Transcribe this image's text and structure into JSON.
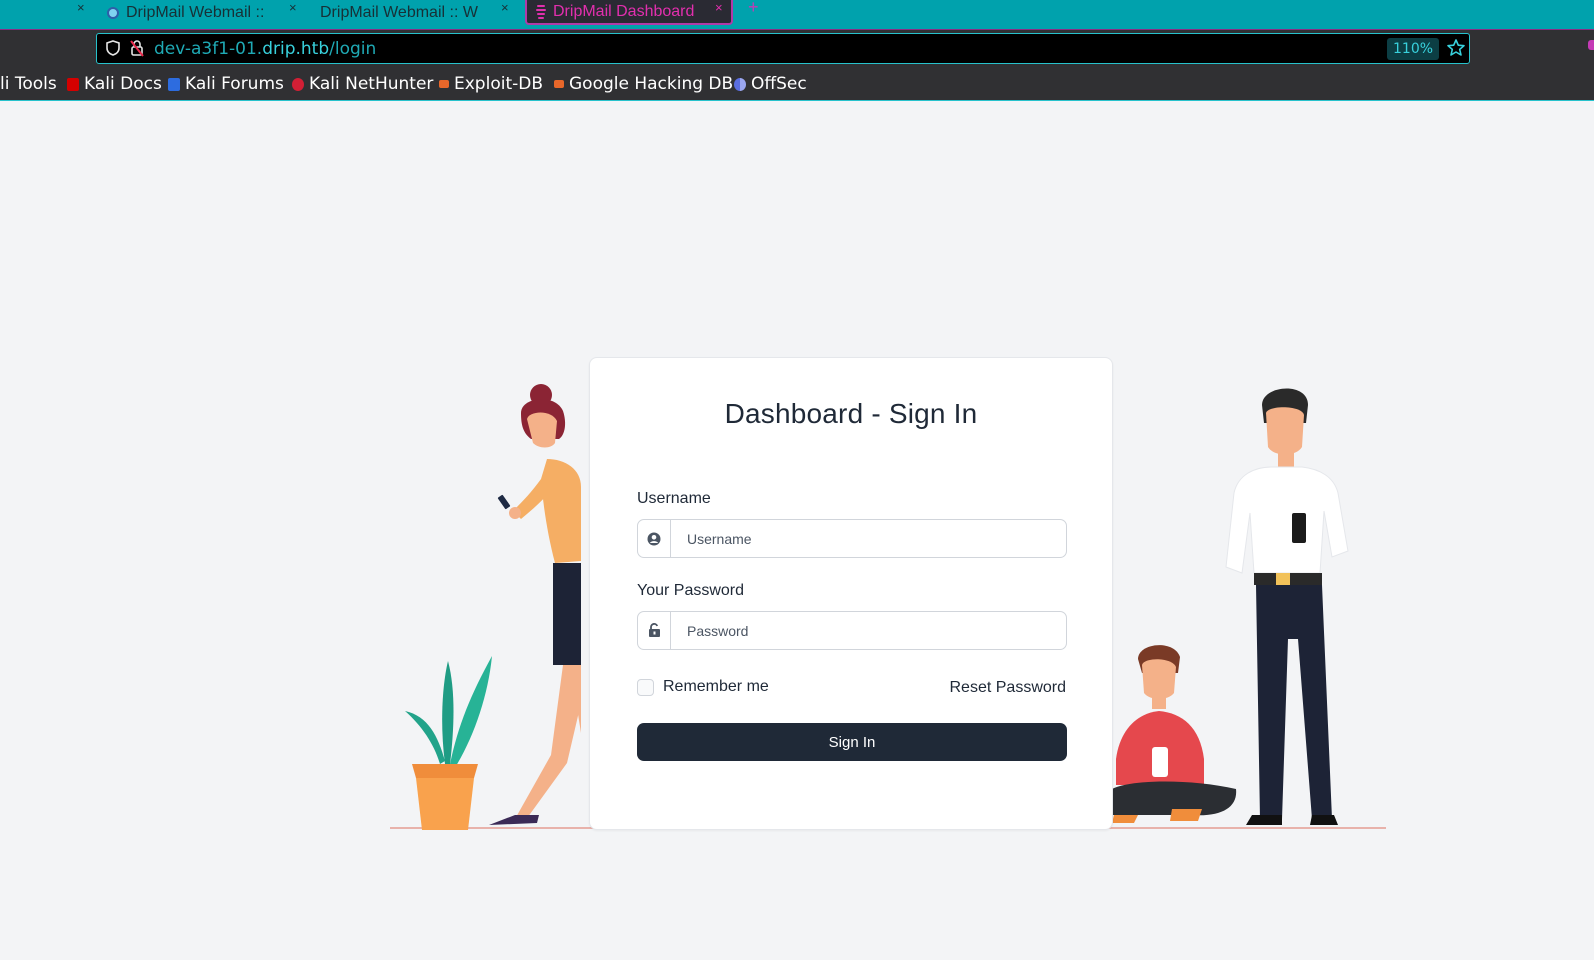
{
  "browser": {
    "tabs": [
      {
        "title": "DripMail Webmail ::",
        "active": false
      },
      {
        "title": "DripMail Webmail :: W",
        "active": false
      },
      {
        "title": "DripMail Dashboard",
        "active": true
      }
    ],
    "close_glyph": "×",
    "new_tab_glyph": "+",
    "url": {
      "prefix": "dev-a3f1-01.",
      "host": "drip.htb",
      "path": "/login"
    },
    "zoom": "110%",
    "bookmarks": [
      {
        "label": "li Tools",
        "icon": "none"
      },
      {
        "label": "Kali Docs",
        "icon": "kali-docs-icon",
        "color": "#d40000"
      },
      {
        "label": "Kali Forums",
        "icon": "kali-forums-icon",
        "color": "#2d6cdf"
      },
      {
        "label": "Kali NetHunter",
        "icon": "kali-nethunter-icon",
        "color": "#d21f35"
      },
      {
        "label": "Exploit-DB",
        "icon": "exploit-db-icon",
        "color": "#e8672a"
      },
      {
        "label": "Google Hacking DB",
        "icon": "ghdb-icon",
        "color": "#e8672a"
      },
      {
        "label": "OffSec",
        "icon": "offsec-icon",
        "color": "#5b6ee1"
      }
    ]
  },
  "login": {
    "title": "Dashboard - Sign In",
    "username_label": "Username",
    "username_placeholder": "Username",
    "password_label": "Your Password",
    "password_placeholder": "Password",
    "remember_label": "Remember me",
    "reset_label": "Reset Password",
    "signin_label": "Sign In"
  },
  "colors": {
    "tabbar": "#00a2ad",
    "accent_pink": "#e22fae",
    "url_cyan": "#38d1dc",
    "page_bg": "#f3f4f6",
    "button_dark": "#1f2937"
  }
}
